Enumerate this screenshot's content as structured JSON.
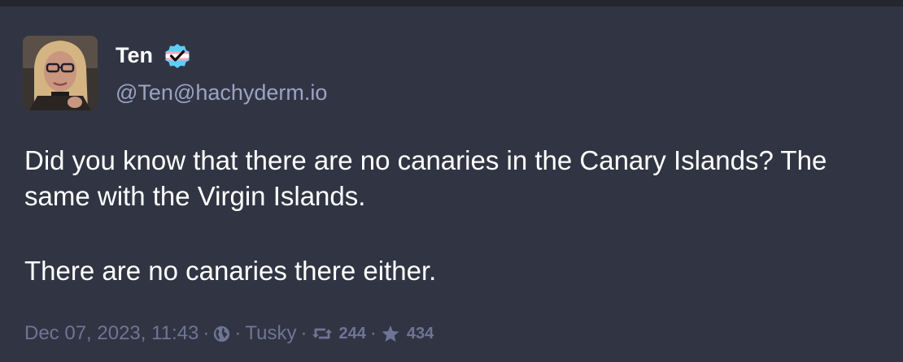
{
  "post": {
    "author": {
      "display_name": "Ten",
      "handle": "@Ten@hachyderm.io",
      "verified_icon": "check-badge-trans-colors-icon"
    },
    "content": [
      "Did you know that there are no canaries in the Canary Islands? The same with the Virgin Islands.",
      "There are no canaries there either."
    ],
    "meta": {
      "timestamp": "Dec 07, 2023, 11:43",
      "separator": "·",
      "visibility_icon": "globe-icon",
      "client": "Tusky",
      "boost_icon": "boost-icon",
      "boosts": "244",
      "favourite_icon": "star-icon",
      "favourites": "434"
    }
  },
  "colors": {
    "background": "#313543",
    "text": "#ffffff",
    "handle": "#9ba3c3",
    "meta": "#6e7595",
    "badge_blue": "#5bcefa",
    "badge_pink": "#f5a9b8"
  }
}
